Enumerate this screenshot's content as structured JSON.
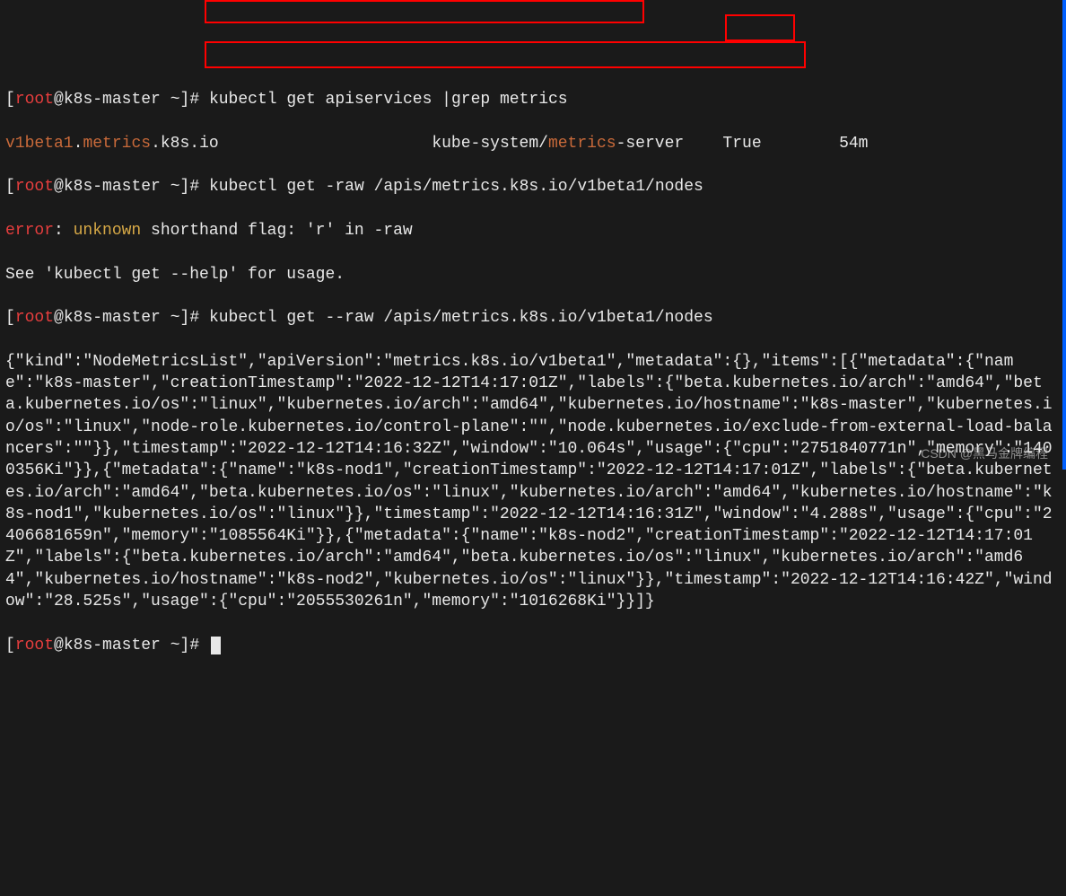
{
  "prompt": {
    "user": "root",
    "host": "k8s-master",
    "cwd": "~",
    "symbol": "#"
  },
  "lines": {
    "cmd1": "kubectl get apiservices |grep metrics",
    "out1_a": "v1beta1",
    "out1_b": ".",
    "out1_c": "metrics",
    "out1_d": ".k8s.io",
    "out1_svc": "kube-system/",
    "out1_svc2": "metrics",
    "out1_svc3": "-server",
    "out1_true": "True",
    "out1_age": "54m",
    "cmd2": "kubectl get -raw /apis/metrics.k8s.io/v1beta1/nodes",
    "err1a": "error",
    "err1b": ": ",
    "err1c": "unknown",
    "err1d": " shorthand flag: 'r' in -raw",
    "see": "See 'kubectl get --help' for usage.",
    "cmd3": "kubectl get --raw /apis/metrics.k8s.io/v1beta1/nodes",
    "json_output": "{\"kind\":\"NodeMetricsList\",\"apiVersion\":\"metrics.k8s.io/v1beta1\",\"metadata\":{},\"items\":[{\"metadata\":{\"name\":\"k8s-master\",\"creationTimestamp\":\"2022-12-12T14:17:01Z\",\"labels\":{\"beta.kubernetes.io/arch\":\"amd64\",\"beta.kubernetes.io/os\":\"linux\",\"kubernetes.io/arch\":\"amd64\",\"kubernetes.io/hostname\":\"k8s-master\",\"kubernetes.io/os\":\"linux\",\"node-role.kubernetes.io/control-plane\":\"\",\"node.kubernetes.io/exclude-from-external-load-balancers\":\"\"}},\"timestamp\":\"2022-12-12T14:16:32Z\",\"window\":\"10.064s\",\"usage\":{\"cpu\":\"2751840771n\",\"memory\":\"1400356Ki\"}},{\"metadata\":{\"name\":\"k8s-nod1\",\"creationTimestamp\":\"2022-12-12T14:17:01Z\",\"labels\":{\"beta.kubernetes.io/arch\":\"amd64\",\"beta.kubernetes.io/os\":\"linux\",\"kubernetes.io/arch\":\"amd64\",\"kubernetes.io/hostname\":\"k8s-nod1\",\"kubernetes.io/os\":\"linux\"}},\"timestamp\":\"2022-12-12T14:16:31Z\",\"window\":\"4.288s\",\"usage\":{\"cpu\":\"2406681659n\",\"memory\":\"1085564Ki\"}},{\"metadata\":{\"name\":\"k8s-nod2\",\"creationTimestamp\":\"2022-12-12T14:17:01Z\",\"labels\":{\"beta.kubernetes.io/arch\":\"amd64\",\"beta.kubernetes.io/os\":\"linux\",\"kubernetes.io/arch\":\"amd64\",\"kubernetes.io/hostname\":\"k8s-nod2\",\"kubernetes.io/os\":\"linux\"}},\"timestamp\":\"2022-12-12T14:16:42Z\",\"window\":\"28.525s\",\"usage\":{\"cpu\":\"2055530261n\",\"memory\":\"1016268Ki\"}}]}"
  },
  "watermark": "CSDN @黑马金牌编程"
}
